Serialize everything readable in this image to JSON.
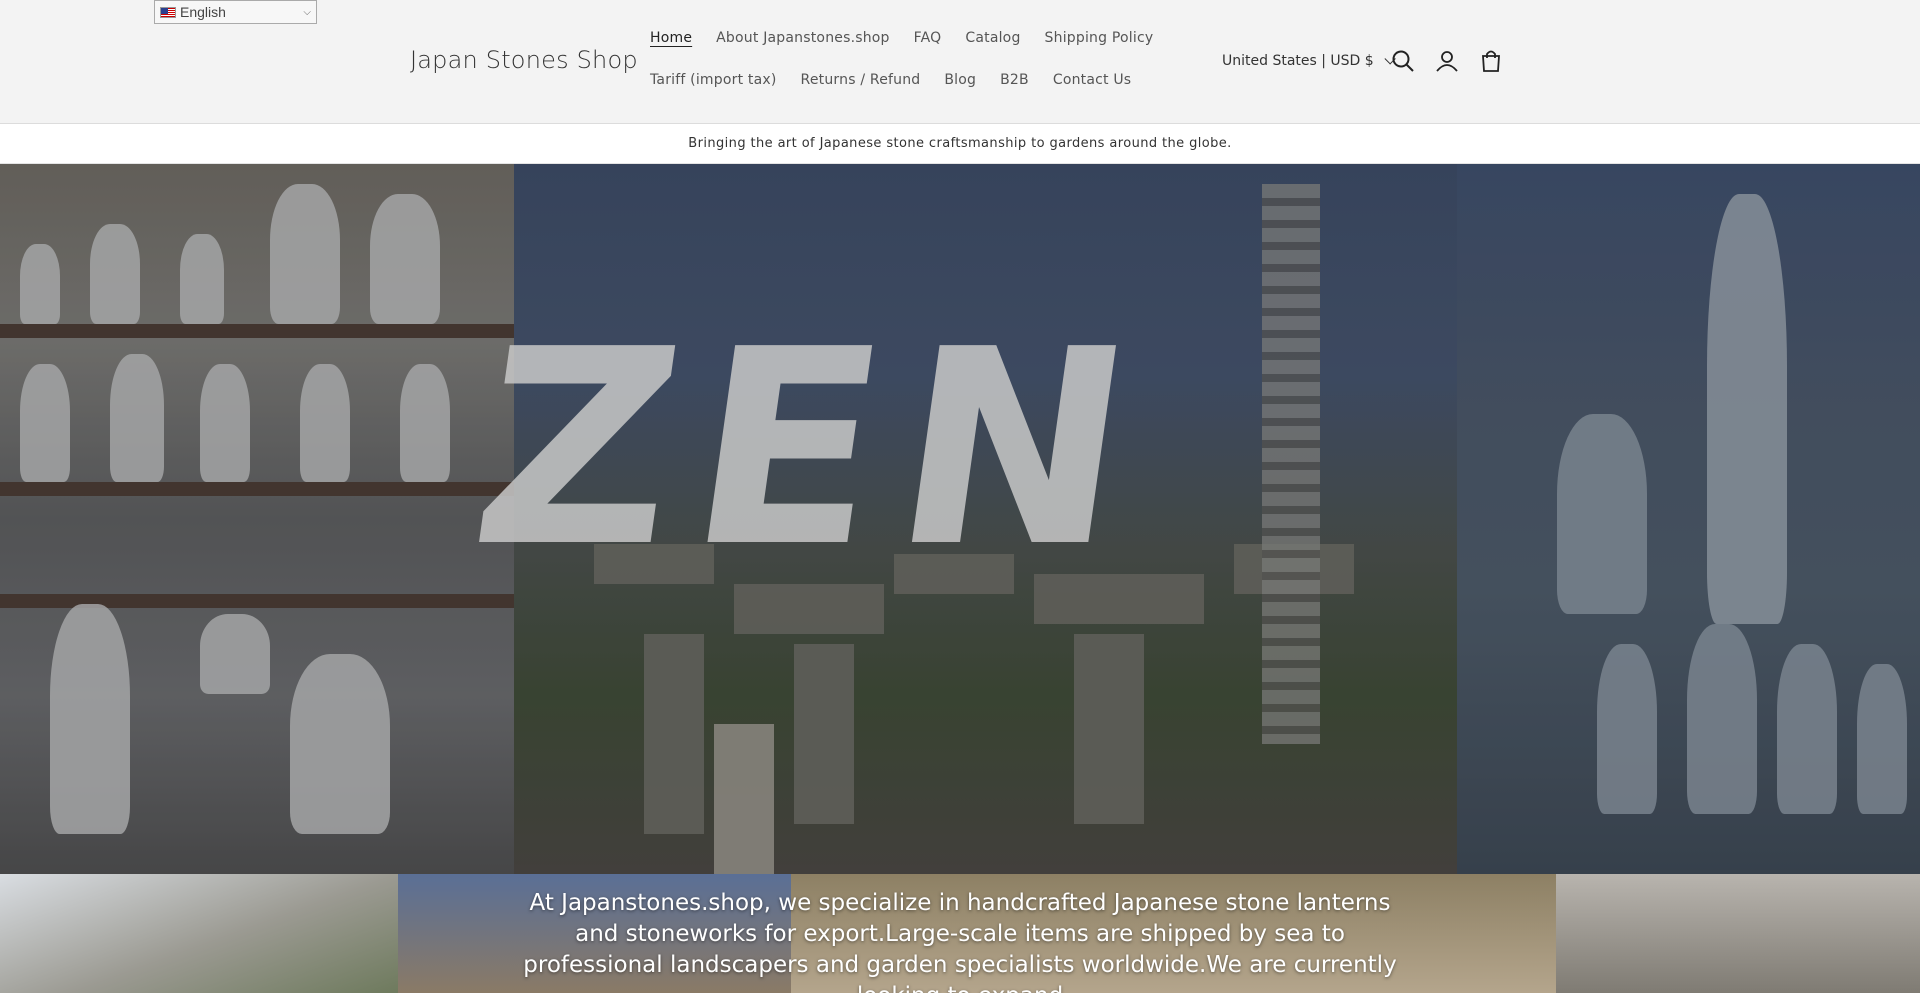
{
  "language_selector": {
    "value": "English"
  },
  "header": {
    "logo": "Japan Stones Shop",
    "nav_row1": [
      "Home",
      "About Japanstones.shop",
      "FAQ",
      "Catalog",
      "Shipping Policy"
    ],
    "nav_row2": [
      "Tariff (import tax)",
      "Returns / Refund",
      "Blog",
      "B2B",
      "Contact Us"
    ],
    "country": "United States | USD $",
    "icons": [
      "search-icon",
      "account-icon",
      "cart-icon"
    ]
  },
  "announcement": "Bringing the art of Japanese stone craftsmanship to gardens around the globe.",
  "hero": {
    "overlay_text": "ZEN"
  },
  "intro": {
    "text": "At Japanstones.shop, we specialize in handcrafted Japanese stone lanterns and stoneworks for export.Large-scale items are shipped by sea to professional landscapers and garden specialists worldwide.We are currently looking to expand"
  },
  "colors": {
    "header_bg": "#f3f3f3",
    "text": "#222222",
    "announce_bg": "#ffffff"
  }
}
